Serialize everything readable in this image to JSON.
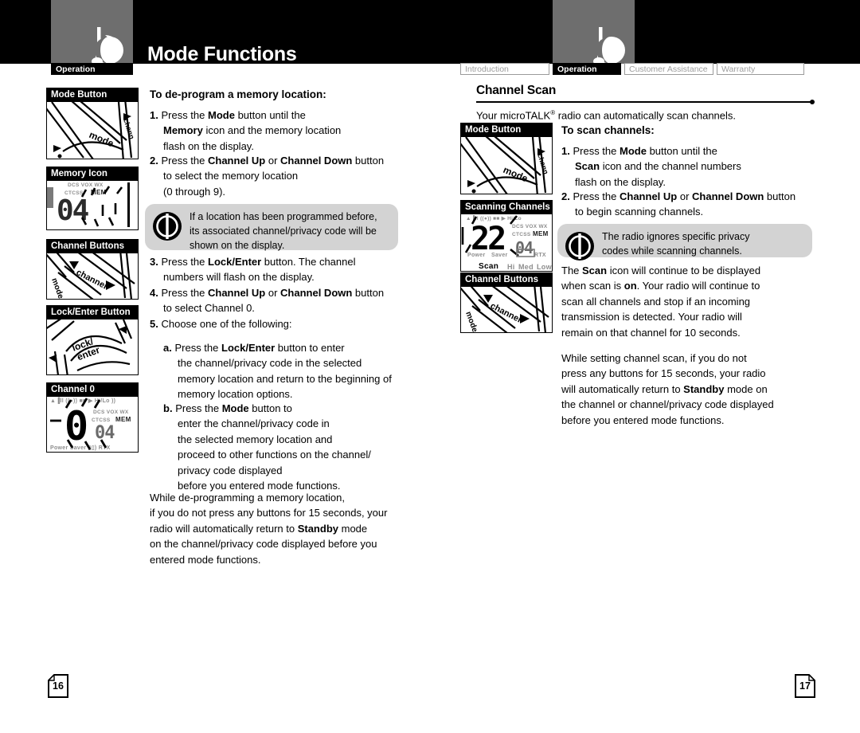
{
  "header": {
    "title": "Mode Functions",
    "logo_icon": "microtalk-radio-logo",
    "tabs": [
      {
        "label": "Operation",
        "active": true
      },
      {
        "label": "Introduction",
        "active": false
      },
      {
        "label": "Operation",
        "active": true
      },
      {
        "label": "Customer Assistance",
        "active": false
      },
      {
        "label": "Warranty",
        "active": false
      }
    ],
    "tabs_right": [
      {
        "label": "Introduction",
        "active": false
      },
      {
        "label": "Operation",
        "active": true
      },
      {
        "label": "Customer Assistance",
        "active": false
      },
      {
        "label": "Warranty",
        "active": false
      }
    ],
    "tab_left_label": "Operation"
  },
  "left_page": {
    "number": "16",
    "heading": "To de-program a memory location:",
    "steps": [
      {
        "marker": "1.",
        "text_html": "Press the <b>Mode</b> button until the<br><b>Memory</b> icon and the memory location<br>flash on the display."
      },
      {
        "marker": "2.",
        "text_html": "Press the <b>Channel Up</b> or <b>Channel Down</b> button<br>to select the memory location<br>(0 through 9)."
      },
      {
        "marker": "3.",
        "text_html": "Press the <b>Lock/Enter</b> button. The channel<br>numbers will flash on the display."
      },
      {
        "marker": "4.",
        "text_html": "Press the <b>Channel Up</b> or <b>Channel Down</b> button<br>to select Channel 0."
      },
      {
        "marker": "5.",
        "text_html": "Choose one of the following:"
      },
      {
        "marker": "a.",
        "text_html": "Press the <b>Lock/Enter</b> button to enter<br>the channel/privacy code in the selected<br>memory location and return to the beginning of<br>memory location options.",
        "sub": true
      },
      {
        "marker": "b.",
        "text_html": "Press the <b>Mode</b> button to<br>enter the channel/privacy code in<br>the selected memory location and<br>proceed to other functions on the channel/<br>privacy code displayed<br>before you entered mode functions.",
        "sub": true
      }
    ],
    "tip": {
      "icon": "power-button-icon",
      "text_html": "If a location has been programmed before,<br>its associated channel/privacy code will be<br>shown on the display."
    },
    "closing_html": "While de-programming a memory location,<br>if you do not press any buttons for 15 seconds, your<br>radio will automatically return to <b>Standby</b> mode<br>on the channel/privacy code displayed before you<br>entered mode functions.",
    "figures": [
      {
        "caption": "Mode Button",
        "kind": "keypad-mode",
        "labels": {
          "key": "mode",
          "side": "channel"
        }
      },
      {
        "caption": "Memory Icon",
        "kind": "lcd-memory",
        "digits": "04",
        "labels": {
          "row1": "DCS VOX WX",
          "row2a": "CTCSS",
          "row2b": "MEM"
        }
      },
      {
        "caption": "Channel Buttons",
        "kind": "keypad-channel",
        "labels": {
          "key": "channel",
          "side": "mode"
        }
      },
      {
        "caption": "Lock/Enter Button",
        "kind": "keypad-lock",
        "labels": {
          "key1": "lock/",
          "key2": "enter"
        }
      },
      {
        "caption": "Channel 0",
        "kind": "lcd-channel0",
        "digits": "0",
        "sub_digits": "04",
        "labels": {
          "row1": "DCS VOX WX",
          "row2a": "CTCSS",
          "row2b": "MEM",
          "top": "Hi/Lo",
          "bottom": "RTX"
        }
      }
    ]
  },
  "right_page": {
    "number": "17",
    "section_title": "Channel Scan",
    "intro_html": "Your microTALK<span class=\"sup\">&reg;</span> radio can automatically scan channels.",
    "sub_heading": "To scan channels:",
    "steps": [
      {
        "marker": "1.",
        "text_html": "Press the <b>Mode</b> button until the<br><b>Scan</b> icon and the channel numbers<br>flash on the display."
      },
      {
        "marker": "2.",
        "text_html": "Press the <b>Channel Up</b> or <b>Channel Down</b> button<br>to begin scanning channels."
      }
    ],
    "tip": {
      "icon": "power-button-icon",
      "text_html": "The radio ignores specific privacy<br>codes while scanning channels."
    },
    "paragraphs": [
      "The <b>Scan</b> icon will continue to be displayed<br>when scan is <b>on</b>. Your radio will continue to<br>scan all channels and stop if an incoming<br>transmission is detected. Your radio will<br>remain on that channel for 10 seconds.",
      "While setting channel scan, if you do not<br>press any buttons for 15 seconds, your radio<br>will automatically return to <b>Standby</b> mode on<br>the channel or channel/privacy code displayed<br>before you entered mode functions."
    ],
    "figures": [
      {
        "caption": "Mode Button",
        "kind": "keypad-mode",
        "labels": {
          "key": "mode",
          "side": "channel"
        }
      },
      {
        "caption": "Scanning Channels",
        "kind": "lcd-scan",
        "digits": "22",
        "sub_digits": "04",
        "labels": {
          "row1": "DCS VOX WX",
          "row2a": "CTCSS",
          "row2b": "MEM",
          "scan": "Scan",
          "hi": "Hi",
          "med": "Med",
          "low": "Low",
          "power": "Power",
          "saver": "Saver",
          "rtx": "RTX"
        }
      },
      {
        "caption": "Channel Buttons",
        "kind": "keypad-channel",
        "labels": {
          "key": "channel",
          "side": "mode"
        }
      }
    ]
  },
  "colors": {
    "ink": "#000000",
    "logo_gray": "#6e6e6e",
    "tip_gray": "#d3d3d3",
    "tab_inactive": "#9d9d9d"
  }
}
